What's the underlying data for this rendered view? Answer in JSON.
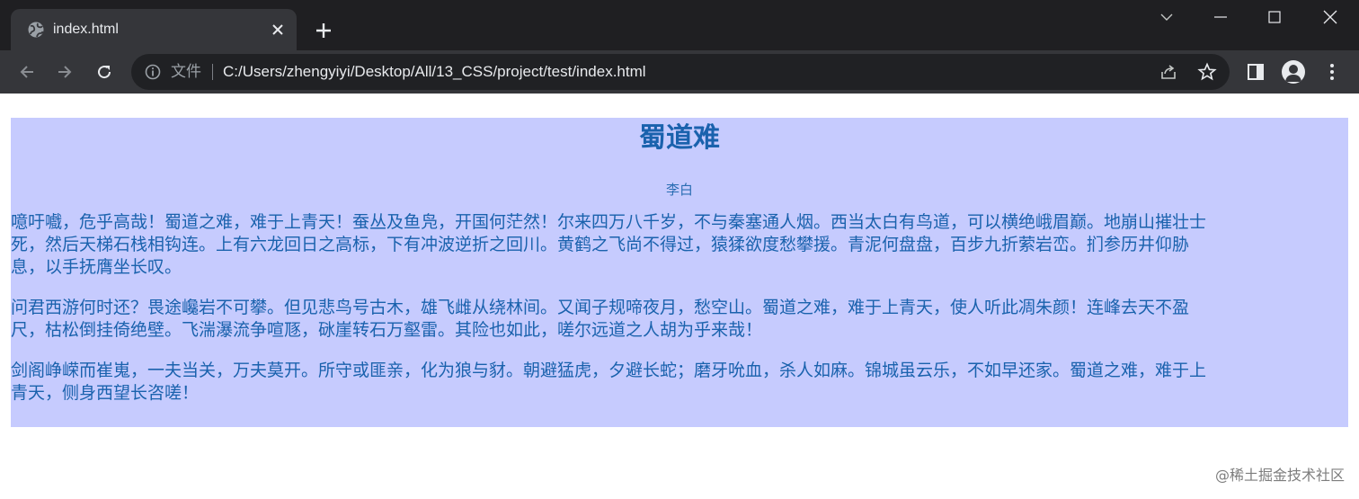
{
  "tab": {
    "title": "index.html",
    "close_label": "×"
  },
  "omnibox": {
    "scheme_label": "文件",
    "url": "C:/Users/zhengyiyi/Desktop/All/13_CSS/project/test/index.html"
  },
  "poem": {
    "title": "蜀道难",
    "author": "李白",
    "paragraphs": [
      {
        "lines": [
          "噫吁嚱，危乎高哉！蜀道之难，难于上青天！蚕丛及鱼凫，开国何茫然！尔来四万八千岁，不与秦塞通人烟。西当太白有鸟道，可以横绝峨眉巅。地崩山摧壮士",
          "死，然后天梯石栈相钩连。上有六龙回日之高标，下有冲波逆折之回川。黄鹤之飞尚不得过，猿猱欲度愁攀援。青泥何盘盘，百步九折萦岩峦。扪参历井仰胁",
          "息，以手抚膺坐长叹。"
        ]
      },
      {
        "lines": [
          "问君西游何时还？畏途巉岩不可攀。但见悲鸟号古木，雄飞雌从绕林间。又闻子规啼夜月，愁空山。蜀道之难，难于上青天，使人听此凋朱颜！连峰去天不盈",
          "尺，枯松倒挂倚绝壁。飞湍瀑流争喧豗，砯崖转石万壑雷。其险也如此，嗟尔远道之人胡为乎来哉！"
        ]
      },
      {
        "lines": [
          "剑阁峥嵘而崔嵬，一夫当关，万夫莫开。所守或匪亲，化为狼与豺。朝避猛虎，夕避长蛇；磨牙吮血，杀人如麻。锦城虽云乐，不如早还家。蜀道之难，难于上",
          "青天，侧身西望长咨嗟！"
        ]
      }
    ]
  },
  "watermark": "@稀土掘金技术社区",
  "colors": {
    "frame": "#1f1f22",
    "toolbar": "#35363a",
    "omnibox": "#202124",
    "content_bg": "#c6cbfe",
    "content_text": "#1a62ad"
  },
  "icons": {
    "favicon": "globe-icon",
    "tab_close": "close-icon",
    "new_tab": "plus-icon",
    "tab_search": "chevron-down-icon",
    "minimize": "minimize-icon",
    "maximize": "maximize-icon",
    "window_close": "window-close-icon",
    "back": "arrow-left-icon",
    "forward": "arrow-right-icon",
    "reload": "reload-icon",
    "site_info": "info-icon",
    "share": "share-icon",
    "bookmark": "star-icon",
    "side_panel": "side-panel-icon",
    "profile": "person-icon",
    "menu": "kebab-menu-icon"
  }
}
